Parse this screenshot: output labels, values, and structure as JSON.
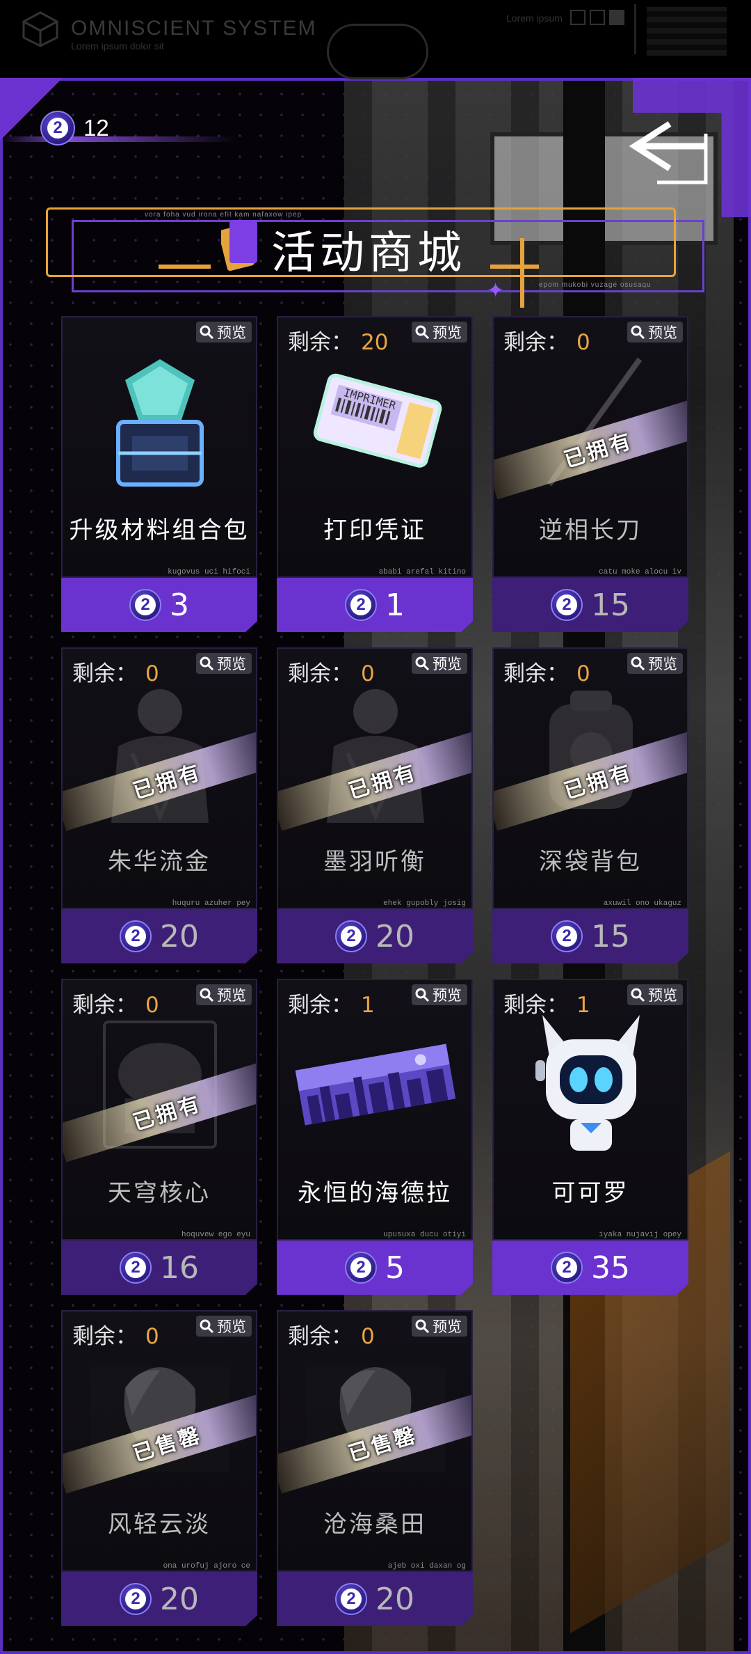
{
  "status_bar": {
    "system_title": "OMNISCIENT SYSTEM",
    "system_subtitle": "Lorem ipsum dolor sit",
    "right_label": "Lorem ipsum"
  },
  "currency": {
    "amount": "12",
    "icon": "stardust-coin-icon"
  },
  "shop": {
    "title": "活动商城",
    "caption_top": "vora foha vud irona efit kam nafaxow ipep",
    "caption_bottom": "epom mukobi vuzage osusaqu"
  },
  "labels": {
    "remaining": "剩余：",
    "preview": "预览",
    "owned": "已拥有",
    "sold_out": "已售罄"
  },
  "items": [
    {
      "name": "升级材料组合包",
      "price": "3",
      "remaining": "",
      "status": "",
      "code": "kugovus uci hifoci",
      "art": "material-pack-icon"
    },
    {
      "name": "打印凭证",
      "price": "1",
      "remaining": "20",
      "status": "",
      "code": "ababi arefal kitino",
      "art": "print-ticket-icon"
    },
    {
      "name": "逆相长刀",
      "price": "15",
      "remaining": "0",
      "status": "已拥有",
      "code": "catu moke alocu iv",
      "art": "blade-icon"
    },
    {
      "name": "朱华流金",
      "price": "20",
      "remaining": "0",
      "status": "已拥有",
      "code": "huquru azuher pey",
      "art": "outfit-icon"
    },
    {
      "name": "墨羽听衡",
      "price": "20",
      "remaining": "0",
      "status": "已拥有",
      "code": "ehek gupobly josig",
      "art": "outfit-icon"
    },
    {
      "name": "深袋背包",
      "price": "15",
      "remaining": "0",
      "status": "已拥有",
      "code": "axuwil ono ukaguz",
      "art": "backpack-icon"
    },
    {
      "name": "天穹核心",
      "price": "16",
      "remaining": "0",
      "status": "已拥有",
      "code": "hoquvew ego eyu",
      "art": "core-icon"
    },
    {
      "name": "永恒的海德拉",
      "price": "5",
      "remaining": "1",
      "status": "",
      "code": "upusuxa ducu otiyi",
      "art": "city-banner-icon"
    },
    {
      "name": "可可罗",
      "price": "35",
      "remaining": "1",
      "status": "",
      "code": "iyaka nujavij opey",
      "art": "robot-pet-icon"
    },
    {
      "name": "风轻云淡",
      "price": "20",
      "remaining": "0",
      "status": "已售罄",
      "code": "ona urofuj ajoro ce",
      "art": "portrait-icon"
    },
    {
      "name": "沧海桑田",
      "price": "20",
      "remaining": "0",
      "status": "已售罄",
      "code": "ajeb oxi daxan og",
      "art": "portrait-icon"
    }
  ],
  "colors": {
    "accent": "#6a32cf",
    "gold": "#e7a33b",
    "background": "#050308"
  }
}
